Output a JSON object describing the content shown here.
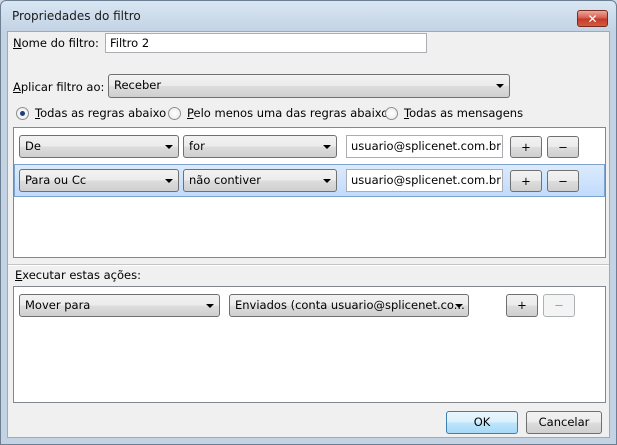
{
  "window": {
    "title": "Propriedades do filtro",
    "close_glyph": "✕"
  },
  "filter_name": {
    "label_prefix": "N",
    "label_rest": "ome do filtro:",
    "value": "Filtro 2"
  },
  "apply_to": {
    "label_prefix": "A",
    "label_rest": "plicar filtro ao:",
    "value": "Receber"
  },
  "match_options": [
    {
      "prefix": "T",
      "rest": "odas as regras abaixo",
      "selected": true
    },
    {
      "prefix": "P",
      "rest": "elo menos uma das regras abaixo",
      "selected": false
    },
    {
      "prefix": "T",
      "rest": "odas as mensagens",
      "selected": false
    }
  ],
  "rules": [
    {
      "field": "De",
      "operator": "for",
      "value": "usuario@splicenet.com.br",
      "selected": false
    },
    {
      "field": "Para ou Cc",
      "operator": "não contiver",
      "value": "usuario@splicenet.com.br",
      "selected": true
    }
  ],
  "actions_label": {
    "prefix": "E",
    "rest": "xecutar estas ações:"
  },
  "actions": [
    {
      "action": "Mover para",
      "target": "Enviados (conta usuario@splicenet.co..."
    }
  ],
  "buttons": {
    "add": "+",
    "remove": "−",
    "ok": "OK",
    "cancel": "Cancelar"
  }
}
